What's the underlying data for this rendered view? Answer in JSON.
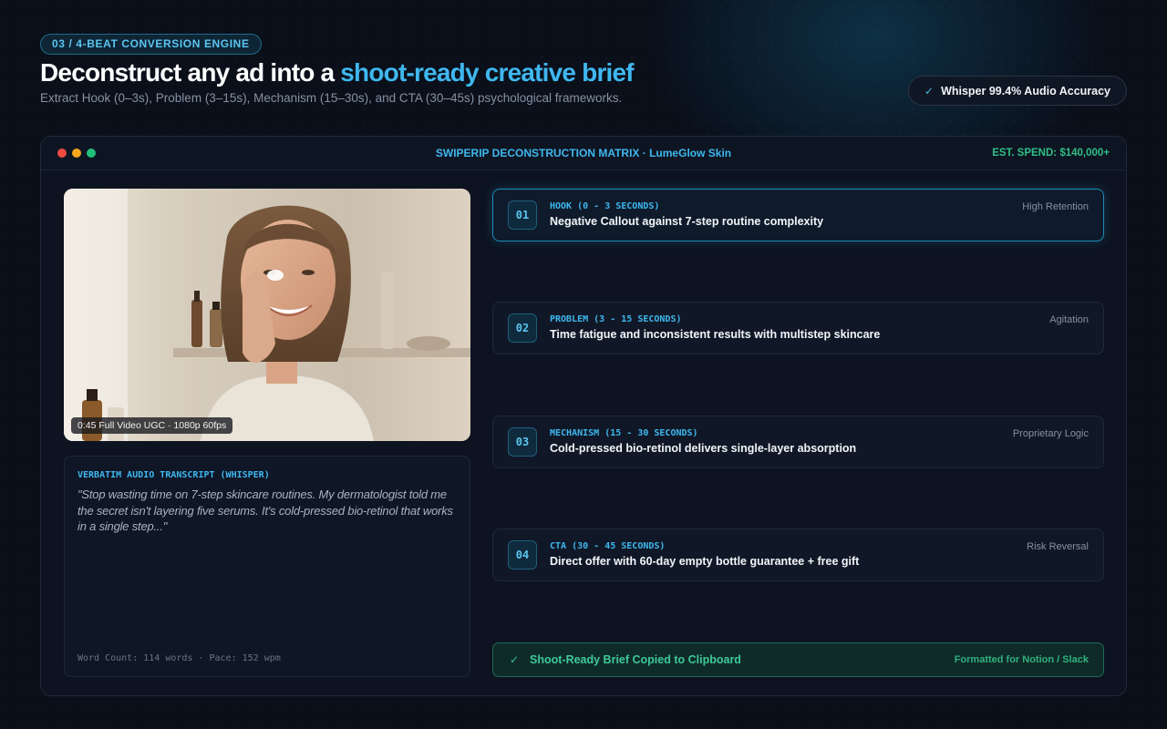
{
  "header": {
    "eyebrow": "03 / 4-BEAT CONVERSION ENGINE",
    "title_prefix": "Deconstruct any ad into a ",
    "title_accent": "shoot-ready creative brief",
    "subtitle": "Extract Hook (0–3s), Problem (3–15s), Mechanism (15–30s), and CTA (30–45s) psychological frameworks.",
    "accuracy_badge": "Whisper 99.4% Audio Accuracy"
  },
  "panel": {
    "title": "SWIPERIP DECONSTRUCTION MATRIX · LumeGlow Skin",
    "spend": "EST. SPEND: $140,000+"
  },
  "video": {
    "caption": "0:45 Full Video UGC · 1080p 60fps"
  },
  "transcript": {
    "label": "VERBATIM AUDIO TRANSCRIPT (WHISPER)",
    "text": "\"Stop wasting time on 7-step skincare routines. My dermatologist told me the secret isn't layering five serums. It's cold-pressed bio-retinol that works in a single step...\"",
    "stats": "Word Count: 114 words · Pace: 152 wpm"
  },
  "beats": [
    {
      "num": "01",
      "label": "HOOK (0 - 3 SECONDS)",
      "title": "Negative Callout against 7-step routine complexity",
      "tag": "High Retention"
    },
    {
      "num": "02",
      "label": "PROBLEM (3 - 15 SECONDS)",
      "title": "Time fatigue and inconsistent results with multistep skincare",
      "tag": "Agitation"
    },
    {
      "num": "03",
      "label": "MECHANISM (15 - 30 SECONDS)",
      "title": "Cold-pressed bio-retinol delivers single-layer absorption",
      "tag": "Proprietary Logic"
    },
    {
      "num": "04",
      "label": "CTA (30 - 45 SECONDS)",
      "title": "Direct offer with 60-day empty bottle guarantee + free gift",
      "tag": "Risk Reversal"
    }
  ],
  "status": {
    "copied": "Shoot-Ready Brief Copied to Clipboard",
    "format": "Formatted for Notion / Slack"
  },
  "icons": {
    "check": "check-icon",
    "window_controls": [
      "close-dot",
      "minimize-dot",
      "maximize-dot"
    ]
  },
  "colors": {
    "accent": "#3fb7ee",
    "success": "#2fbf86",
    "background": "#0a0f1a"
  }
}
